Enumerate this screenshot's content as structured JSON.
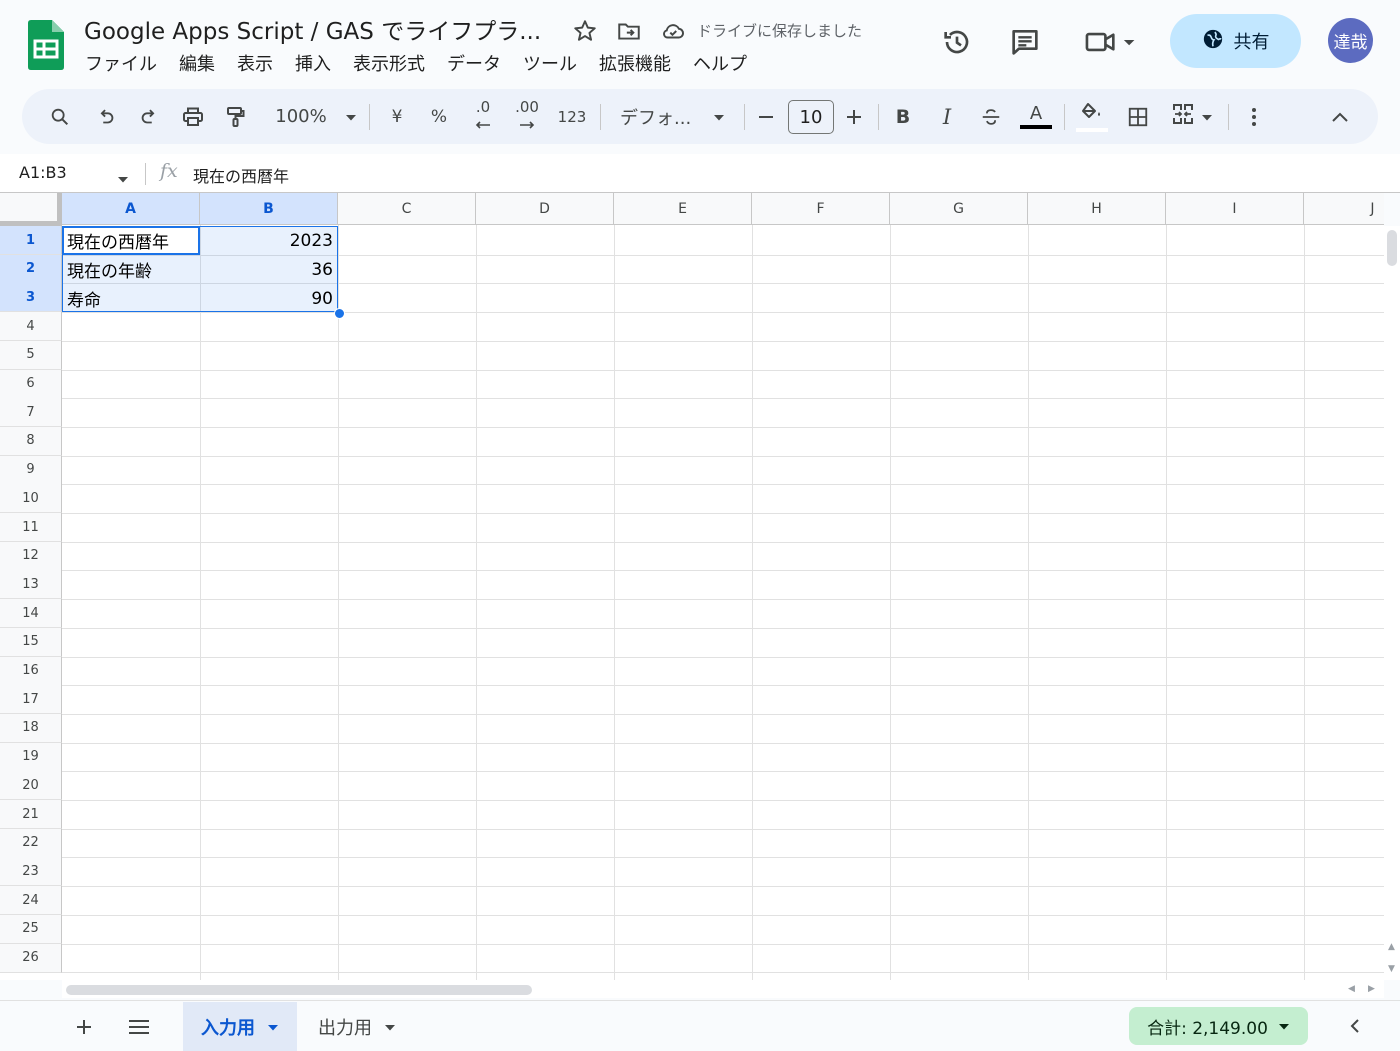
{
  "doc": {
    "title": "Google Apps Script / GAS でライフプラ...",
    "save_status": "ドライブに保存しました"
  },
  "menu": [
    "ファイル",
    "編集",
    "表示",
    "挿入",
    "表示形式",
    "データ",
    "ツール",
    "拡張機能",
    "ヘルプ"
  ],
  "header": {
    "share_label": "共有",
    "avatar_initials": "達哉"
  },
  "toolbar": {
    "zoom": "100%",
    "currency": "¥",
    "percent": "%",
    "decimal_decrease": ".0",
    "decimal_increase": ".00",
    "number_format": "123",
    "font": "デフォ...",
    "font_size": "10",
    "bold": "B",
    "italic": "I",
    "text_color_letter": "A"
  },
  "formula_bar": {
    "name_box": "A1:B3",
    "content": "現在の西暦年"
  },
  "columns": [
    "A",
    "B",
    "C",
    "D",
    "E",
    "F",
    "G",
    "H",
    "I",
    "J"
  ],
  "rows": [
    "1",
    "2",
    "3",
    "4",
    "5",
    "6",
    "7",
    "8",
    "9",
    "10",
    "11",
    "12",
    "13",
    "14",
    "15",
    "16",
    "17",
    "18",
    "19",
    "20",
    "21",
    "22",
    "23",
    "24",
    "25",
    "26"
  ],
  "cells": [
    {
      "label": "現在の西暦年",
      "value": "2023"
    },
    {
      "label": "現在の年齢",
      "value": "36"
    },
    {
      "label": "寿命",
      "value": "90"
    }
  ],
  "sheets": {
    "active": "入力用",
    "other": "出力用"
  },
  "summary": "合計: 2,149.00",
  "colors": {
    "accent": "#1a73e8",
    "share_bg": "#c2e7ff",
    "sum_bg": "#c4eed0",
    "logo_green": "#0f9d58"
  }
}
